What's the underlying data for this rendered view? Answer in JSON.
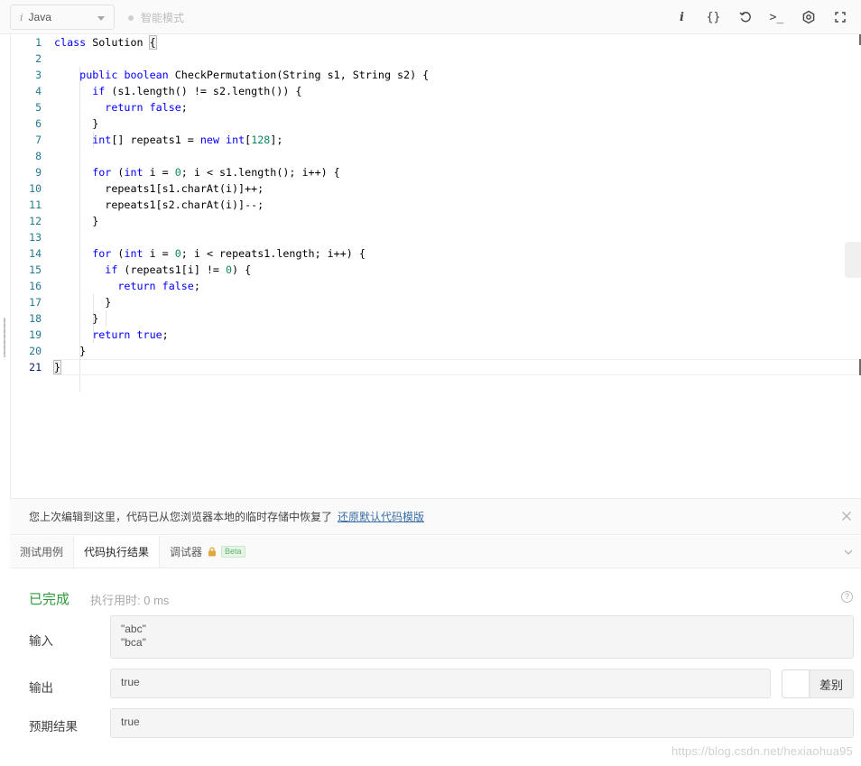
{
  "toolbar": {
    "language": "Java",
    "smart_mode": "智能模式",
    "icons": [
      "info-icon",
      "format-braces-icon",
      "reset-icon",
      "console-icon",
      "settings-icon",
      "fullscreen-icon"
    ],
    "format_label": "{}",
    "info_label": "i",
    "console_label": ">_"
  },
  "editor": {
    "line_numbers": [
      "1",
      "2",
      "3",
      "4",
      "5",
      "6",
      "7",
      "8",
      "9",
      "10",
      "11",
      "12",
      "13",
      "14",
      "15",
      "16",
      "17",
      "18",
      "19",
      "20",
      "21"
    ]
  },
  "notice": {
    "text": "您上次编辑到这里，代码已从您浏览器本地的临时存储中恢复了",
    "restore_link": "还原默认代码模版"
  },
  "tabs": {
    "items": [
      {
        "label": "测试用例"
      },
      {
        "label": "代码执行结果"
      },
      {
        "label": "调试器"
      }
    ],
    "beta": "Beta"
  },
  "result": {
    "status": "已完成",
    "time": "执行用时: 0 ms",
    "input_label": "输入",
    "input_lines": [
      "\"abc\"",
      "\"bca\""
    ],
    "output_label": "输出",
    "output": "true",
    "expected_label": "预期结果",
    "expected": "true",
    "diff_label": "差别"
  },
  "watermark": "https://blog.csdn.net/hexiaohua95",
  "colors": {
    "keyword": "#0000ff",
    "number": "#09885a",
    "line_number": "#237893",
    "success": "#2e9b3b",
    "link": "#3a6ea5"
  }
}
